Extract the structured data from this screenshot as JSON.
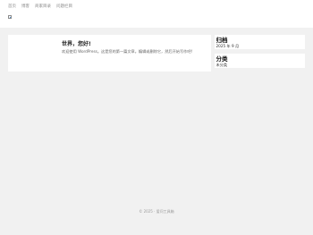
{
  "nav": {
    "items": [
      "首页",
      "博客",
      "商家目录",
      "问题栏目"
    ]
  },
  "post": {
    "title": "世界，您好!",
    "excerpt": "欢迎使用 WordPress。这是您的第一篇文章。编辑或删除它，然后开始写作吧!"
  },
  "sidebar": {
    "archive_title": "归档",
    "archive_item": "2025 年 9 月",
    "category_title": "分类",
    "category_item": "未分类"
  },
  "footer": {
    "text": "© 2025 · 爱问工具箱"
  }
}
